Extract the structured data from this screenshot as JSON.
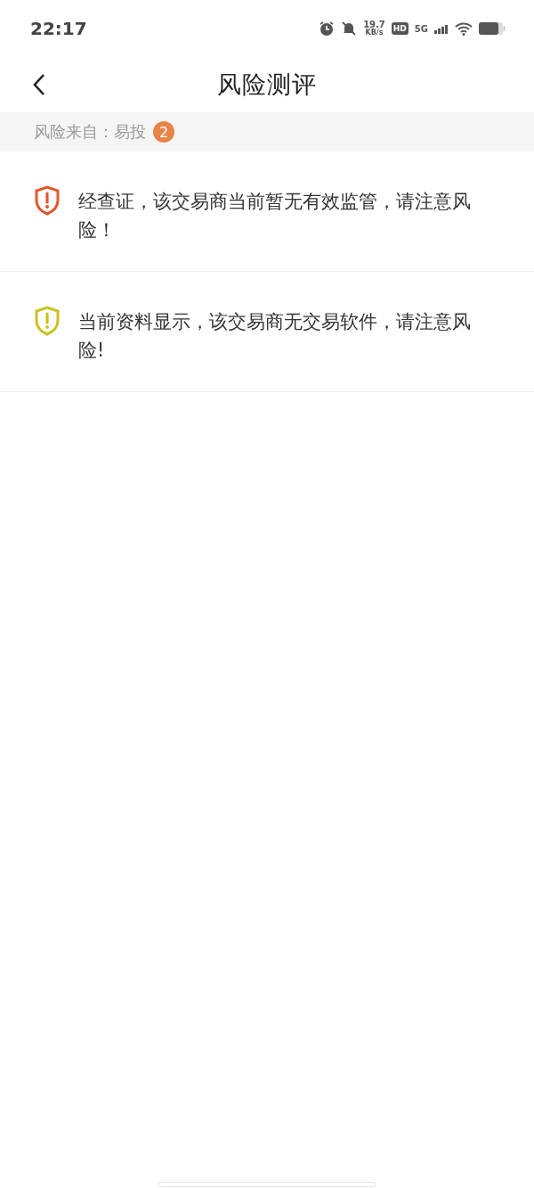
{
  "status_bar": {
    "time": "22:17",
    "speed_value": "19.7",
    "speed_unit": "KB/s",
    "hd": "HD",
    "network": "5G"
  },
  "header": {
    "title": "风险测评"
  },
  "source": {
    "label": "风险来自：易投",
    "count": "2"
  },
  "risks": [
    {
      "text": "经查证，该交易商当前暂无有效监管，请注意风险！",
      "color": "#e4572e"
    },
    {
      "text": "当前资料显示，该交易商无交易软件，请注意风险!",
      "color": "#c9c21f"
    }
  ]
}
